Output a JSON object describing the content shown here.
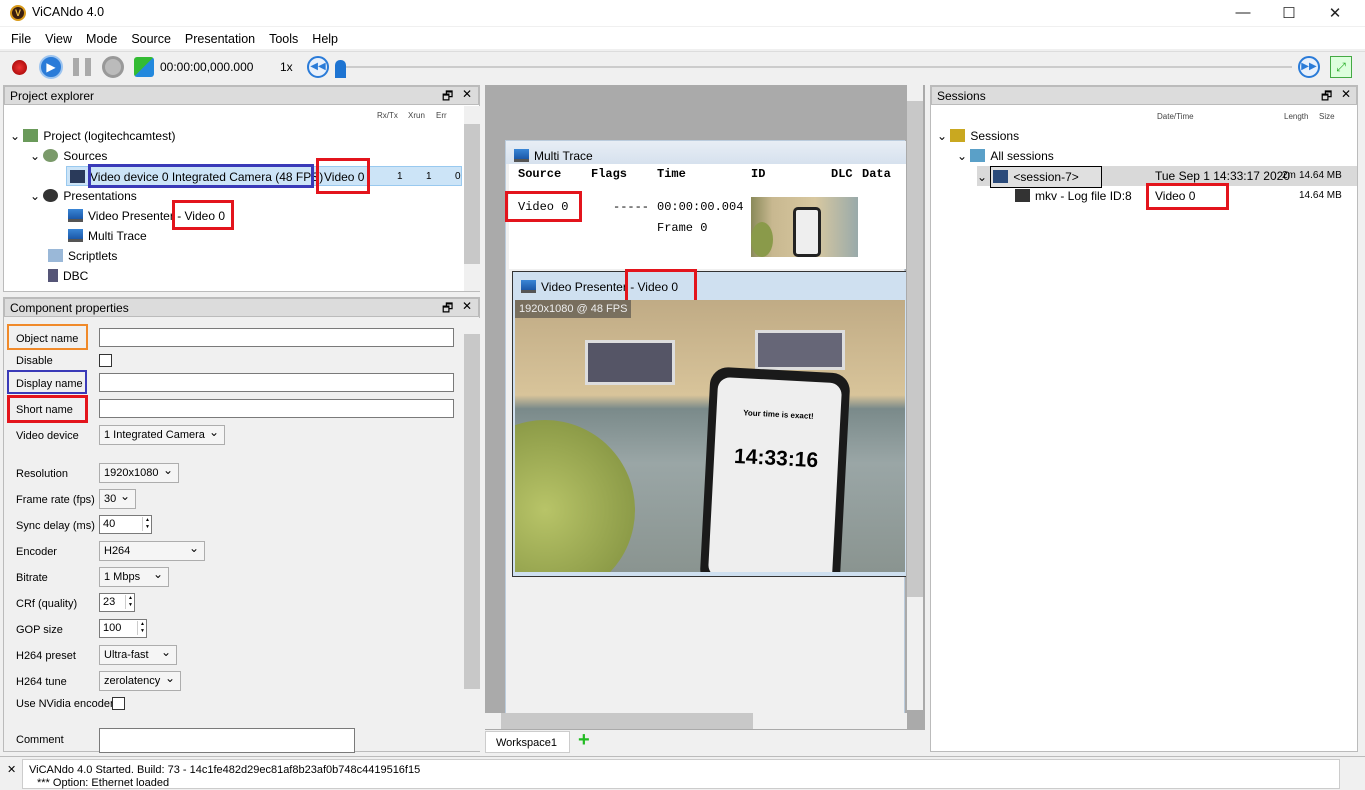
{
  "app": {
    "title": "ViCANdo 4.0",
    "logo_letter": "V"
  },
  "menu": [
    "File",
    "View",
    "Mode",
    "Source",
    "Presentation",
    "Tools",
    "Help"
  ],
  "toolbar": {
    "time": "00:00:00,000.000",
    "speed": "1x"
  },
  "project_explorer": {
    "title": "Project explorer",
    "columns": [
      "Rx/Tx",
      "Xrun",
      "Err"
    ],
    "project": "Project (logitechcamtest)",
    "sources": "Sources",
    "video_device": "Video device 0 Integrated Camera (48 FPS)",
    "video_device_short": "Video 0",
    "rx": "1",
    "xrun": "1",
    "err": "0",
    "presentations": "Presentations",
    "video_presenter": "Video Presenter",
    "video_presenter_short": "- Video 0",
    "multi_trace": "Multi Trace",
    "scriptlets": "Scriptlets",
    "dbc": "DBC"
  },
  "component_properties": {
    "title": "Component properties",
    "object_name": "Object name",
    "disable": "Disable",
    "display_name": "Display name",
    "short_name": "Short name",
    "video_device": {
      "label": "Video device",
      "value": "1 Integrated Camera"
    },
    "resolution": {
      "label": "Resolution",
      "value": "1920x1080"
    },
    "frame_rate": {
      "label": "Frame rate (fps)",
      "value": "30"
    },
    "sync_delay": {
      "label": "Sync delay (ms)",
      "value": "40"
    },
    "encoder": {
      "label": "Encoder",
      "value": "H264"
    },
    "bitrate": {
      "label": "Bitrate",
      "value": "1 Mbps"
    },
    "crf": {
      "label": "CRf (quality)",
      "value": "23"
    },
    "gop": {
      "label": "GOP size",
      "value": "100"
    },
    "preset": {
      "label": "H264 preset",
      "value": "Ultra-fast"
    },
    "tune": {
      "label": "H264 tune",
      "value": "zerolatency"
    },
    "nvidia": "Use NVidia encoder",
    "comment": "Comment"
  },
  "multi_trace": {
    "title": "Multi Trace",
    "columns": [
      "Source",
      "Flags",
      "Time",
      "ID",
      "DLC",
      "Data"
    ],
    "row": {
      "source": "Video 0",
      "flags": "-----",
      "time": "00:00:00.004",
      "frame": "Frame 0"
    }
  },
  "video_presenter": {
    "title": "Video Presenter",
    "short": "- Video 0",
    "overlay": "1920x1080 @ 48 FPS",
    "phone_clock": "14:33:16",
    "phone_heading": "Your time is exact!"
  },
  "workspace": {
    "tab": "Workspace1"
  },
  "sessions": {
    "title": "Sessions",
    "columns": [
      "Date/Time",
      "Length",
      "Size"
    ],
    "root": "Sessions",
    "all": "All sessions",
    "session": {
      "name": "<session-7>",
      "datetime": "Tue Sep 1 14:33:17 2020",
      "length": "2m",
      "size": "14.64 MB"
    },
    "log": {
      "name": "mkv - Log file ID:8",
      "short": "Video 0",
      "size": "14.64 MB"
    }
  },
  "log": {
    "lines": [
      "ViCANdo 4.0 Started. Build: 73 - 14c1fe482d29ec81af8b23af0b748c4419516f15",
      "*** Option: Ethernet loaded"
    ]
  }
}
